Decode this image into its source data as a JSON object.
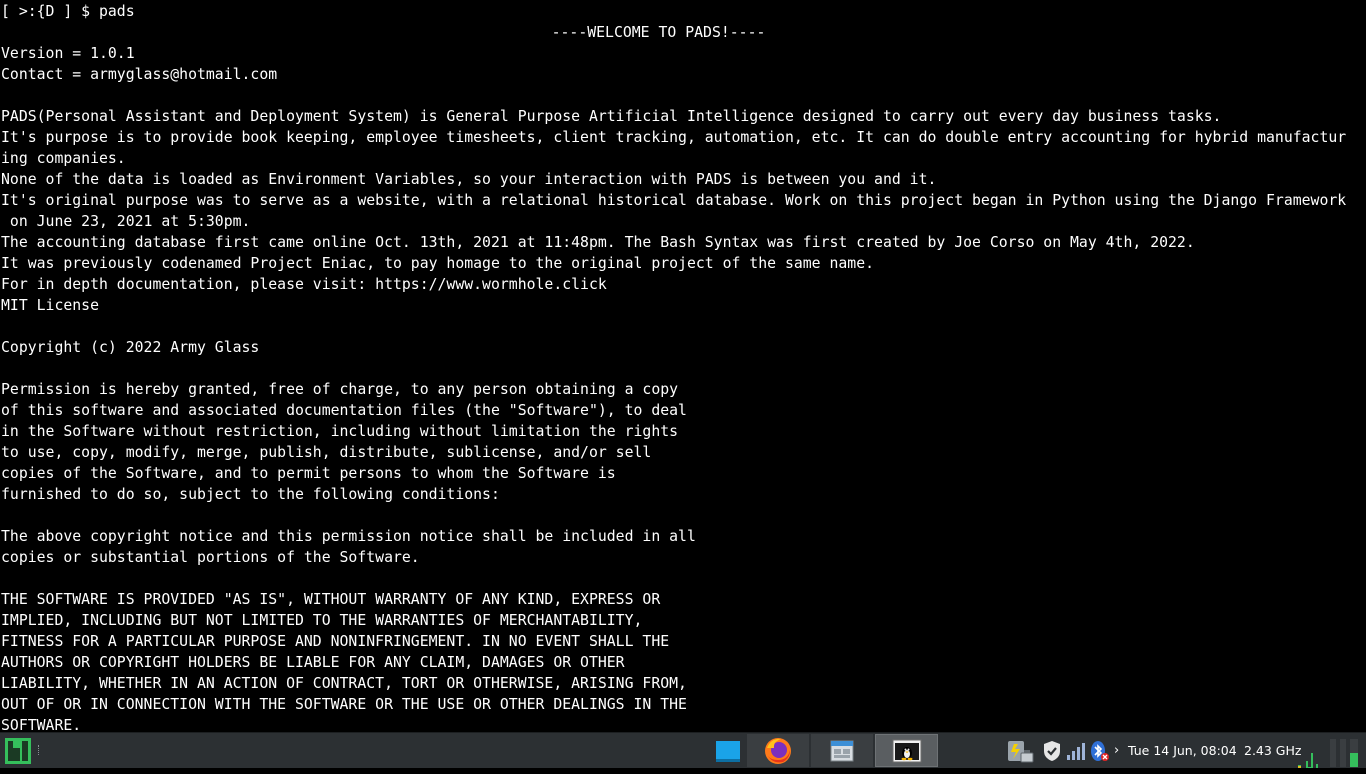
{
  "terminal": {
    "lines": [
      "[ >:{D ] $ pads",
      "----WELCOME TO PADS!----",
      "Version = 1.0.1",
      "Contact = armyglass@hotmail.com",
      "",
      "PADS(Personal Assistant and Deployment System) is General Purpose Artificial Intelligence designed to carry out every day business tasks.",
      "It's purpose is to provide book keeping, employee timesheets, client tracking, automation, etc. It can do double entry accounting for hybrid manufactur",
      "ing companies.",
      "None of the data is loaded as Environment Variables, so your interaction with PADS is between you and it.",
      "It's original purpose was to serve as a website, with a relational historical database. Work on this project began in Python using the Django Framework",
      " on June 23, 2021 at 5:30pm.",
      "The accounting database first came online Oct. 13th, 2021 at 11:48pm. The Bash Syntax was first created by Joe Corso on May 4th, 2022.",
      "It was previously codenamed Project Eniac, to pay homage to the original project of the same name.",
      "For in depth documentation, please visit: https://www.wormhole.click",
      "MIT License",
      "",
      "Copyright (c) 2022 Army Glass",
      "",
      "Permission is hereby granted, free of charge, to any person obtaining a copy",
      "of this software and associated documentation files (the \"Software\"), to deal",
      "in the Software without restriction, including without limitation the rights",
      "to use, copy, modify, merge, publish, distribute, sublicense, and/or sell",
      "copies of the Software, and to permit persons to whom the Software is",
      "furnished to do so, subject to the following conditions:",
      "",
      "The above copyright notice and this permission notice shall be included in all",
      "copies or substantial portions of the Software.",
      "",
      "THE SOFTWARE IS PROVIDED \"AS IS\", WITHOUT WARRANTY OF ANY KIND, EXPRESS OR",
      "IMPLIED, INCLUDING BUT NOT LIMITED TO THE WARRANTIES OF MERCHANTABILITY,",
      "FITNESS FOR A PARTICULAR PURPOSE AND NONINFRINGEMENT. IN NO EVENT SHALL THE",
      "AUTHORS OR COPYRIGHT HOLDERS BE LIABLE FOR ANY CLAIM, DAMAGES OR OTHER",
      "LIABILITY, WHETHER IN AN ACTION OF CONTRACT, TORT OR OTHERWISE, ARISING FROM,",
      "OUT OF OR IN CONNECTION WITH THE SOFTWARE OR THE USE OR OTHER DEALINGS IN THE",
      "SOFTWARE."
    ]
  },
  "taskbar": {
    "start_icon": "manjaro-logo-icon",
    "windows": [
      {
        "icon": "desktop-icon"
      },
      {
        "icon": "firefox-icon"
      },
      {
        "icon": "file-manager-icon"
      },
      {
        "icon": "terminal-icon"
      }
    ],
    "tray_icons": [
      "power-manager-icon",
      "shield-icon",
      "network-signal-icon",
      "bluetooth-icon"
    ],
    "clock": "Tue 14 Jun, 08:04",
    "cpu_freq": "2.43 GHz",
    "chevron": "›",
    "colors": {
      "background": "#2c3033",
      "accent": "#35bf5c",
      "desktop_blue": "#1aa3e8"
    }
  }
}
